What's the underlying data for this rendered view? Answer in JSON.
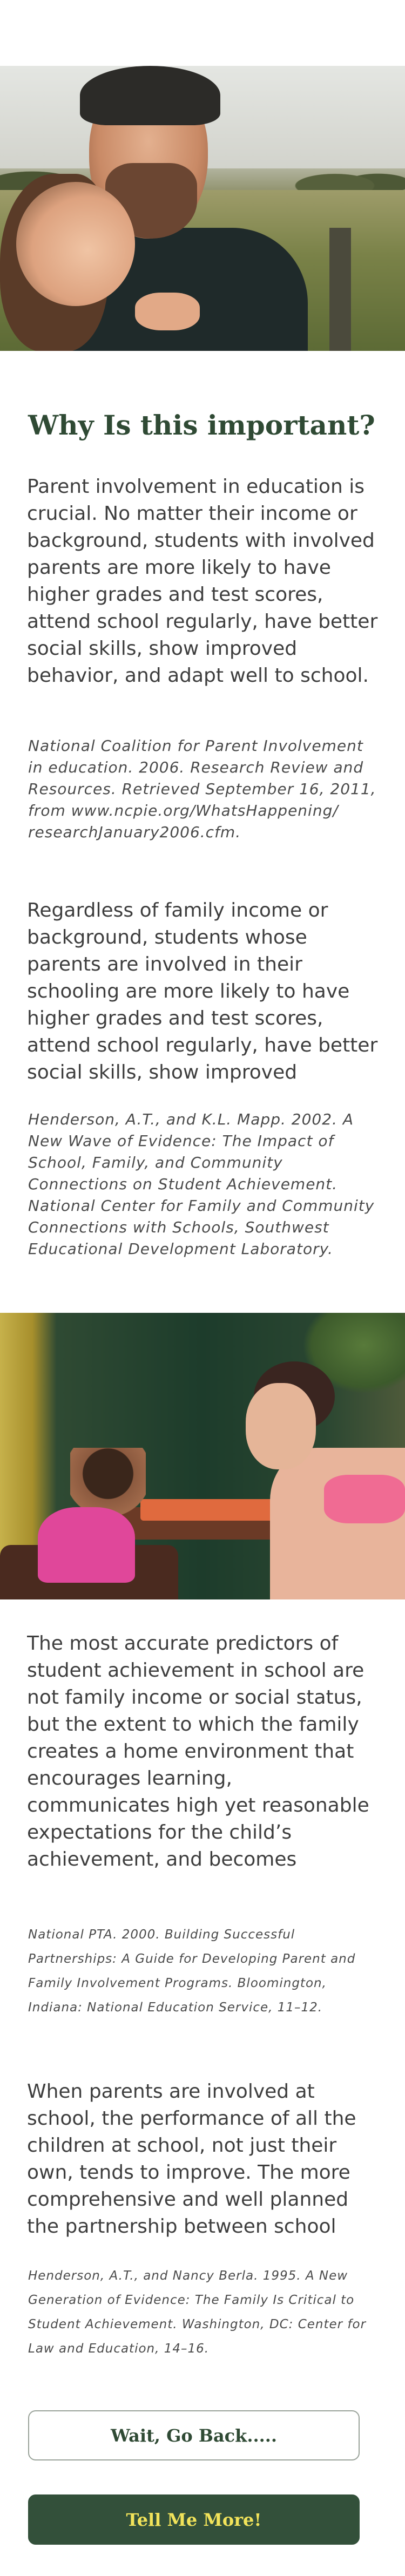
{
  "heading": "Why Is this important?",
  "sections": [
    {
      "body": "Parent involvement in education is crucial. No matter their income or background, students with involved parents are more likely to have higher grades and test scores, attend school regularly, have better social skills, show improved behavior, and adapt well to school.",
      "citation": "National Coalition for Parent Involvement in education. 2006. Research Review and Resources. Retrieved September 16, 2011, from www.ncpie.org/WhatsHappening/ researchJanuary2006.cfm."
    },
    {
      "body": "Regardless of family income or background, students whose parents are involved in their schooling are more likely to have higher grades and test scores, attend school regularly, have better social skills, show improved",
      "citation": "Henderson, A.T., and K.L. Mapp. 2002. A New Wave of Evidence: The Impact of School, Family, and Community Connections on Student Achievement. National Center for Family and Community Connections with Schools, Southwest Educational Development Laboratory."
    },
    {
      "body": "The most accurate predictors of student achievement in school are not family income or social status, but the extent to which the family creates a home environment that encourages learning, communicates high yet reasonable expectations for the child’s achievement, and becomes involved in the child’s",
      "citation": "National PTA. 2000. Building Successful Partnerships: A Guide for Developing Parent and Family Involvement Programs. Bloomington, Indiana: National Education Service, 11–12."
    },
    {
      "body": "When parents are involved at school, the performance of all the children at school, not just their own, tends to improve. The more comprehensive and well planned the partnership between school",
      "citation": "Henderson, A.T., and Nancy Berla. 1995. A New Generation of Evidence: The Family Is Critical to Student Achievement. Washington, DC: Center for Law and Education, 14–16."
    }
  ],
  "buttons": {
    "back_label": "Wait, Go Back.....",
    "more_label": "Tell Me More!"
  },
  "colors": {
    "heading": "#2f4a34",
    "primary_button_bg": "#33503a",
    "primary_button_text": "#f2e35a"
  }
}
